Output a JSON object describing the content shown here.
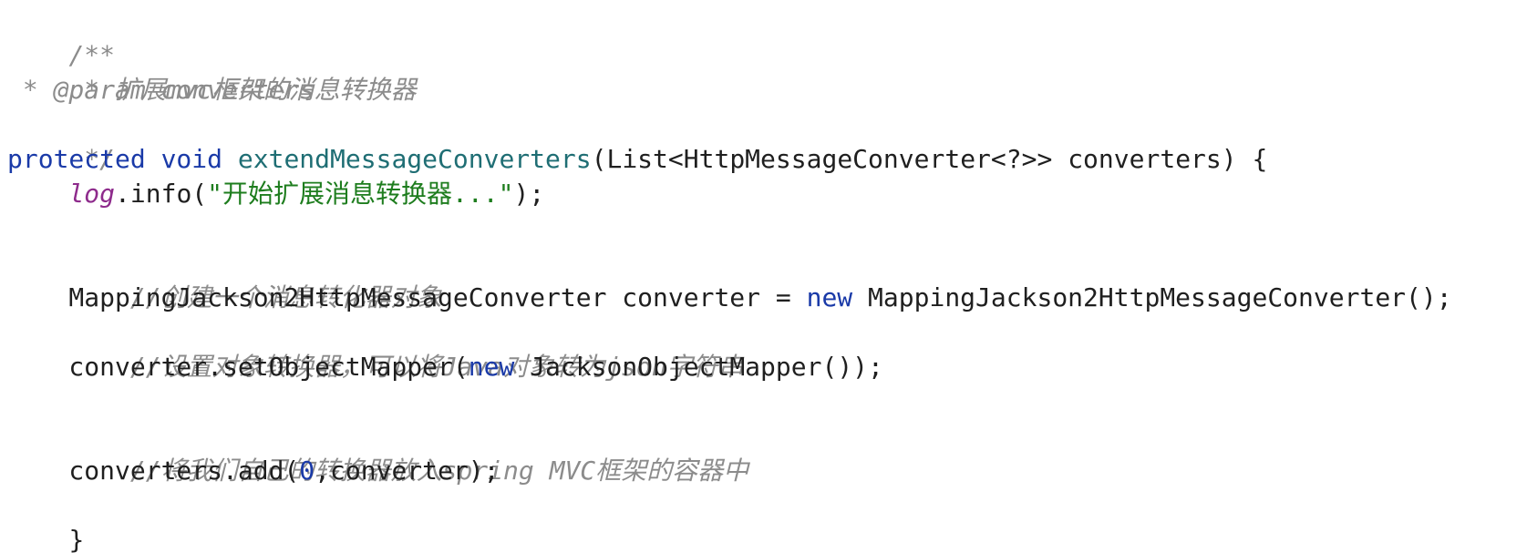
{
  "code": {
    "doc_open": "/**",
    "doc_desc": " * 扩展mvc框架的消息转换器",
    "doc_param_tag": " * @param",
    "doc_param_name": " converters",
    "doc_close": " */",
    "sig_protected": "protected",
    "sig_void": "void",
    "sig_method": "extendMessageConverters",
    "sig_params": "(List<HttpMessageConverter<?>> converters) {",
    "log_indent": "    ",
    "log_field": "log",
    "log_call": ".info(",
    "log_string": "\"开始扩展消息转换器...\"",
    "log_end": ");",
    "comment_create": "    //创建一个消息转化器对象",
    "decl_lhs": "    MappingJackson2HttpMessageConverter converter = ",
    "decl_new": "new",
    "decl_rhs": " MappingJackson2HttpMessageConverter();",
    "comment_set": "    //设置对象转换器，可以将Java对象转为json字符串",
    "set_lhs": "    converter.setObjectMapper(",
    "set_new": "new",
    "set_rhs": " JacksonObjectMapper());",
    "comment_add": "    //将我们自己的转换器放入spring MVC框架的容器中",
    "add_lhs": "    converters.add(",
    "add_num": "0",
    "add_rhs": ",converter);",
    "close_brace": "}"
  },
  "colors": {
    "keyword": "#1a3aa8",
    "method": "#1f6e74",
    "comment": "#8c8c8c",
    "field": "#8e2b8c",
    "string": "#1e7d1e",
    "background": "#ffffff"
  }
}
